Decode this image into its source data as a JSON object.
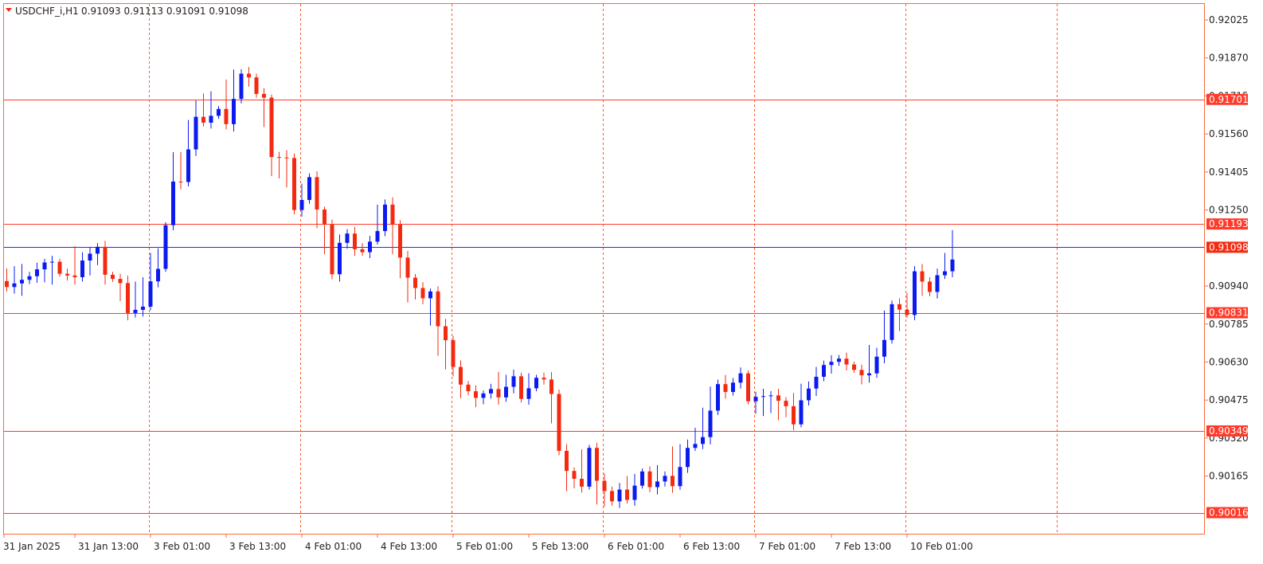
{
  "header": {
    "symbol": "USDCHF_i,H1",
    "ohlc": "0.91093 0.91113 0.91091 0.91098"
  },
  "colors": {
    "bull": "#0b1bf0",
    "bear": "#f42a10",
    "axis": "#ff6a3d",
    "grid": "#ff5a2a",
    "level": "#ff3a2a",
    "bid": "#1d2df5"
  },
  "chart_data": {
    "type": "candlestick",
    "y_range": [
      0.8993,
      0.9209
    ],
    "y_ticks": [
      "0.92025",
      "0.91870",
      "0.91715",
      "0.91560",
      "0.91405",
      "0.91250",
      "0.90940",
      "0.90785",
      "0.90630",
      "0.90475",
      "0.90320",
      "0.90165"
    ],
    "x_ticks": [
      "31 Jan 2025",
      "31 Jan 13:00",
      "3 Feb 01:00",
      "3 Feb 13:00",
      "4 Feb 01:00",
      "4 Feb 13:00",
      "5 Feb 01:00",
      "5 Feb 13:00",
      "6 Feb 01:00",
      "6 Feb 13:00",
      "7 Feb 01:00",
      "7 Feb 13:00",
      "10 Feb 01:00"
    ],
    "day_separators": 7,
    "levels": [
      {
        "value": 0.91701,
        "label": "0.91701"
      },
      {
        "value": 0.91193,
        "label": "0.91193"
      },
      {
        "value": 0.90831,
        "label": "0.90831"
      },
      {
        "value": 0.90349,
        "label": "0.90349"
      },
      {
        "value": 0.90016,
        "label": "0.90016"
      }
    ],
    "bid": {
      "value": 0.91098,
      "label": "0.91098"
    },
    "segments": [
      [
        0,
        0.9096,
        0.91,
        0.9093
      ],
      [
        3,
        0.9098,
        0.9097,
        0.9102
      ],
      [
        5,
        0.9102,
        0.9093,
        0.9097
      ],
      [
        7,
        0.9101,
        0.9099,
        0.9103
      ],
      [
        9,
        0.9098,
        0.9108,
        0.9112
      ],
      [
        10,
        0.9104,
        0.9106,
        0.9101
      ],
      [
        12,
        0.9108,
        0.91,
        0.9104
      ],
      [
        13,
        0.9101,
        0.9093,
        0.9097
      ],
      [
        15,
        0.9096,
        0.9081,
        0.909
      ],
      [
        16,
        0.9083,
        0.9094,
        0.9089
      ],
      [
        18,
        0.9084,
        0.9106,
        0.9101
      ],
      [
        20,
        0.9103,
        0.9107,
        0.9104
      ],
      [
        22,
        0.9137,
        0.9147,
        0.9143
      ],
      [
        23,
        0.9136,
        0.9163,
        0.9158
      ],
      [
        25,
        0.9161,
        0.9167,
        0.9163
      ],
      [
        26,
        0.9163,
        0.9171,
        0.9167
      ],
      [
        28,
        0.9167,
        0.9161,
        0.9165
      ],
      [
        29,
        0.916,
        0.9186,
        0.9184
      ],
      [
        31,
        0.9179,
        0.9179,
        0.9178
      ],
      [
        34,
        0.9172,
        0.9147,
        0.9152
      ],
      [
        35,
        0.9147,
        0.9139,
        0.914
      ],
      [
        37,
        0.9145,
        0.9112,
        0.9117
      ],
      [
        38,
        0.9123,
        0.9133,
        0.9127
      ],
      [
        40,
        0.914,
        0.9129,
        0.9135
      ],
      [
        41,
        0.9126,
        0.9115,
        0.912
      ],
      [
        42,
        0.9119,
        0.91,
        0.9105
      ],
      [
        43,
        0.9098,
        0.9111,
        0.9106
      ],
      [
        44,
        0.911,
        0.9112,
        0.9113
      ],
      [
        45,
        0.9113,
        0.9109,
        0.9111
      ],
      [
        47,
        0.9109,
        0.911,
        0.9115
      ],
      [
        49,
        0.9116,
        0.9126,
        0.9122
      ],
      [
        50,
        0.9126,
        0.9116,
        0.912
      ],
      [
        51,
        0.9117,
        0.9095,
        0.9099
      ],
      [
        53,
        0.9099,
        0.9085,
        0.909
      ],
      [
        55,
        0.9089,
        0.9093,
        0.9094
      ],
      [
        56,
        0.9091,
        0.9075,
        0.9079
      ],
      [
        57,
        0.9076,
        0.9058,
        0.9063
      ],
      [
        59,
        0.9063,
        0.9053,
        0.9059
      ],
      [
        60,
        0.9055,
        0.905,
        0.9051
      ],
      [
        62,
        0.9048,
        0.9049,
        0.9047
      ],
      [
        64,
        0.905,
        0.905,
        0.9052
      ],
      [
        65,
        0.9051,
        0.9056,
        0.9054
      ],
      [
        67,
        0.9058,
        0.9052,
        0.9055
      ],
      [
        68,
        0.9048,
        0.9056,
        0.9052
      ],
      [
        70,
        0.9055,
        0.9054,
        0.9058
      ],
      [
        72,
        0.9052,
        0.903,
        0.9035
      ],
      [
        73,
        0.9028,
        0.9021,
        0.9027
      ],
      [
        74,
        0.9019,
        0.9009,
        0.9013
      ],
      [
        76,
        0.9011,
        0.9028,
        0.9023
      ],
      [
        77,
        0.9026,
        0.9016,
        0.9021
      ],
      [
        78,
        0.9017,
        0.9002,
        0.9007
      ],
      [
        80,
        0.9007,
        0.9005,
        0.901
      ],
      [
        81,
        0.9011,
        0.9007,
        0.9009
      ],
      [
        82,
        0.9006,
        0.9015,
        0.901
      ],
      [
        84,
        0.9016,
        0.9018,
        0.9015
      ],
      [
        85,
        0.9014,
        0.9018,
        0.9019
      ],
      [
        87,
        0.9017,
        0.901,
        0.9014
      ],
      [
        88,
        0.9012,
        0.9028,
        0.9024
      ],
      [
        90,
        0.9026,
        0.9029,
        0.9032
      ],
      [
        91,
        0.9032,
        0.9035,
        0.9032
      ],
      [
        92,
        0.9034,
        0.905,
        0.9046
      ],
      [
        94,
        0.9054,
        0.905,
        0.9048
      ],
      [
        95,
        0.905,
        0.9055,
        0.9052
      ],
      [
        97,
        0.9056,
        0.9051,
        0.9055
      ],
      [
        98,
        0.9049,
        0.9054,
        0.9051
      ],
      [
        99,
        0.905,
        0.9046,
        0.9044
      ],
      [
        101,
        0.9049,
        0.904,
        0.9044
      ],
      [
        102,
        0.9046,
        0.9043,
        0.9042
      ],
      [
        104,
        0.904,
        0.9048,
        0.9044
      ],
      [
        105,
        0.9049,
        0.9053,
        0.9051
      ],
      [
        107,
        0.9057,
        0.9058,
        0.906
      ],
      [
        108,
        0.9061,
        0.9059,
        0.9061
      ],
      [
        110,
        0.9062,
        0.906,
        0.9063
      ],
      [
        111,
        0.9064,
        0.906,
        0.9062
      ],
      [
        113,
        0.9058,
        0.9054,
        0.9056
      ],
      [
        114,
        0.9058,
        0.9067,
        0.9072
      ],
      [
        116,
        0.907,
        0.9088,
        0.9085
      ],
      [
        117,
        0.9089,
        0.9072,
        0.9078
      ],
      [
        119,
        0.9083,
        0.909,
        0.9096
      ],
      [
        120,
        0.91,
        0.9095,
        0.9093
      ],
      [
        122,
        0.909,
        0.9095,
        0.9093
      ],
      [
        124,
        0.9102,
        0.9106,
        0.9107
      ],
      [
        125,
        0.9106,
        0.9117,
        0.9116
      ],
      [
        126,
        0.9119,
        0.9113,
        0.9116
      ],
      [
        128,
        0.911,
        0.9109,
        0.911
      ]
    ]
  }
}
